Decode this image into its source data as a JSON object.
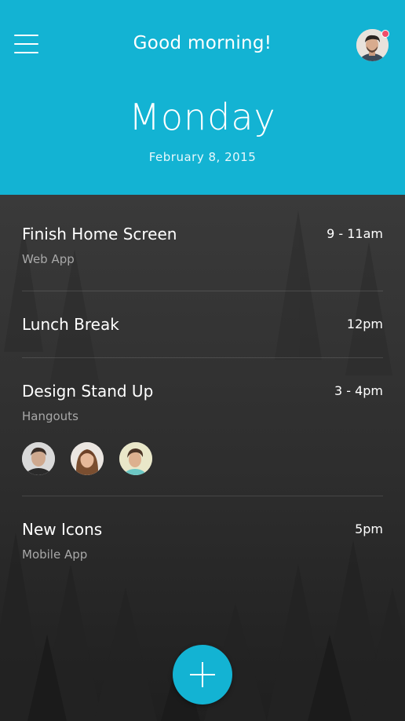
{
  "header": {
    "greeting": "Good morning!",
    "day": "Monday",
    "date": "February 8, 2015",
    "background_color": "#13b3d3",
    "has_notification": true,
    "notification_color": "#f04e6b"
  },
  "events": [
    {
      "title": "Finish Home Screen",
      "time": "9 - 11am",
      "subtitle": "Web App"
    },
    {
      "title": "Lunch Break",
      "time": "12pm",
      "subtitle": ""
    },
    {
      "title": "Design Stand Up",
      "time": "3 - 4pm",
      "subtitle": "Hangouts",
      "attendees": [
        "attendee-1",
        "attendee-2",
        "attendee-3"
      ]
    },
    {
      "title": "New Icons",
      "time": "5pm",
      "subtitle": "Mobile App"
    }
  ],
  "icons": {
    "menu": "menu-icon",
    "add": "plus-icon"
  },
  "colors": {
    "accent": "#13b3d3",
    "list_background": "#2a2a2a"
  }
}
